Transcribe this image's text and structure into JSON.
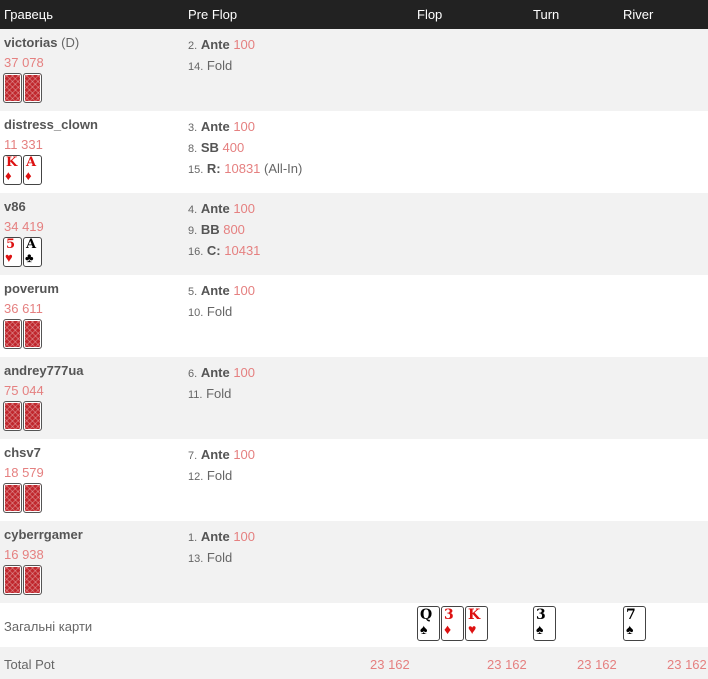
{
  "header": {
    "player": "Гравець",
    "preflop": "Pre Flop",
    "flop": "Flop",
    "turn": "Turn",
    "river": "River"
  },
  "players": [
    {
      "name": "victorias",
      "dealer": "(D)",
      "stack": "37 078",
      "cards": [
        {
          "back": true
        },
        {
          "back": true
        }
      ],
      "actions": [
        {
          "num": "2.",
          "type": "Ante",
          "amount": "100"
        },
        {
          "num": "14.",
          "fold": "Fold"
        }
      ]
    },
    {
      "name": "distress_clown",
      "stack": "11 331",
      "cards": [
        {
          "rank": "K",
          "suit": "♦",
          "color": "red"
        },
        {
          "rank": "A",
          "suit": "♦",
          "color": "red"
        }
      ],
      "actions": [
        {
          "num": "3.",
          "type": "Ante",
          "amount": "100"
        },
        {
          "num": "8.",
          "type": "SB",
          "amount": "400"
        },
        {
          "num": "15.",
          "type": "R:",
          "amount": "10831",
          "note": "(All-In)"
        }
      ]
    },
    {
      "name": "v86",
      "stack": "34 419",
      "cards": [
        {
          "rank": "5",
          "suit": "♥",
          "color": "red"
        },
        {
          "rank": "A",
          "suit": "♣",
          "color": "black"
        }
      ],
      "actions": [
        {
          "num": "4.",
          "type": "Ante",
          "amount": "100"
        },
        {
          "num": "9.",
          "type": "BB",
          "amount": "800"
        },
        {
          "num": "16.",
          "type": "C:",
          "amount": "10431"
        }
      ]
    },
    {
      "name": "poverum",
      "stack": "36 611",
      "cards": [
        {
          "back": true
        },
        {
          "back": true
        }
      ],
      "actions": [
        {
          "num": "5.",
          "type": "Ante",
          "amount": "100"
        },
        {
          "num": "10.",
          "fold": "Fold"
        }
      ]
    },
    {
      "name": "andrey777ua",
      "stack": "75 044",
      "cards": [
        {
          "back": true
        },
        {
          "back": true
        }
      ],
      "actions": [
        {
          "num": "6.",
          "type": "Ante",
          "amount": "100"
        },
        {
          "num": "11.",
          "fold": "Fold"
        }
      ]
    },
    {
      "name": "chsv7",
      "stack": "18 579",
      "cards": [
        {
          "back": true
        },
        {
          "back": true
        }
      ],
      "actions": [
        {
          "num": "7.",
          "type": "Ante",
          "amount": "100"
        },
        {
          "num": "12.",
          "fold": "Fold"
        }
      ]
    },
    {
      "name": "cyberrgamer",
      "stack": "16 938",
      "cards": [
        {
          "back": true
        },
        {
          "back": true
        }
      ],
      "actions": [
        {
          "num": "1.",
          "type": "Ante",
          "amount": "100"
        },
        {
          "num": "13.",
          "fold": "Fold"
        }
      ]
    }
  ],
  "board": {
    "label": "Загальні карти",
    "flop": [
      {
        "rank": "Q",
        "suit": "♠",
        "color": "black"
      },
      {
        "rank": "3",
        "suit": "♦",
        "color": "red"
      },
      {
        "rank": "K",
        "suit": "♥",
        "color": "red"
      }
    ],
    "turn": [
      {
        "rank": "3",
        "suit": "♠",
        "color": "black"
      }
    ],
    "river": [
      {
        "rank": "7",
        "suit": "♠",
        "color": "black"
      }
    ]
  },
  "pot": {
    "label": "Total Pot",
    "preflop": "23 162",
    "flop": "23 162",
    "turn": "23 162",
    "river": "23 162"
  },
  "colors": {
    "header_bg": "#222222",
    "amount": "#e58080",
    "alt_row": "#f2f2f2",
    "card_back": "#c0272d"
  }
}
